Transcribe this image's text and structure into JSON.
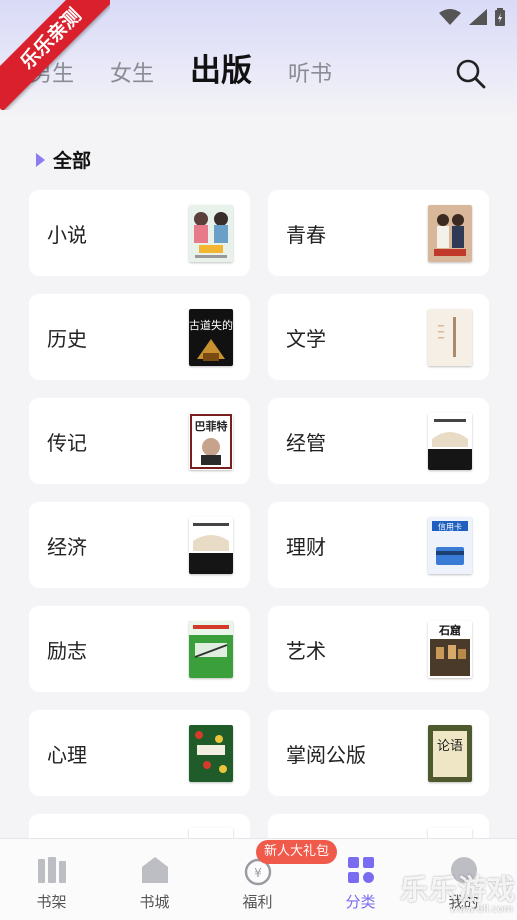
{
  "ribbon_text": "乐乐亲测",
  "tabs": [
    {
      "label": "男生",
      "active": false
    },
    {
      "label": "女生",
      "active": false
    },
    {
      "label": "出版",
      "active": true
    },
    {
      "label": "听书",
      "active": false
    }
  ],
  "section_title": "全部",
  "categories": [
    {
      "label": "小说",
      "cover": "novel-cover"
    },
    {
      "label": "青春",
      "cover": "youth-cover"
    },
    {
      "label": "历史",
      "cover": "history-cover"
    },
    {
      "label": "文学",
      "cover": "literature-cover"
    },
    {
      "label": "传记",
      "cover": "biography-cover"
    },
    {
      "label": "经管",
      "cover": "management-cover"
    },
    {
      "label": "经济",
      "cover": "economy-cover"
    },
    {
      "label": "理财",
      "cover": "finance-cover"
    },
    {
      "label": "励志",
      "cover": "inspiration-cover"
    },
    {
      "label": "艺术",
      "cover": "art-cover"
    },
    {
      "label": "心理",
      "cover": "psychology-cover"
    },
    {
      "label": "掌阅公版",
      "cover": "public-domain-cover"
    }
  ],
  "covers_text": {
    "history_title": "古道失的",
    "biography_title": "巴菲特",
    "finance_title": "信用卡",
    "art_title": "石窟",
    "public_domain_title": "论语"
  },
  "bottom_nav": [
    {
      "label": "书架",
      "icon": "bookshelf-icon",
      "active": false
    },
    {
      "label": "书城",
      "icon": "store-icon",
      "active": false
    },
    {
      "label": "福利",
      "icon": "welfare-icon",
      "active": false
    },
    {
      "label": "分类",
      "icon": "category-icon",
      "active": true
    },
    {
      "label": "我的",
      "icon": "profile-icon",
      "active": false
    }
  ],
  "promo_badge": "新人大礼包",
  "watermark": "乐乐游戏",
  "watermark_url": "www.6ll.com",
  "colors": {
    "accent": "#7a6cf0",
    "ribbon": "#d9202c",
    "badge": "#f05a4b"
  }
}
